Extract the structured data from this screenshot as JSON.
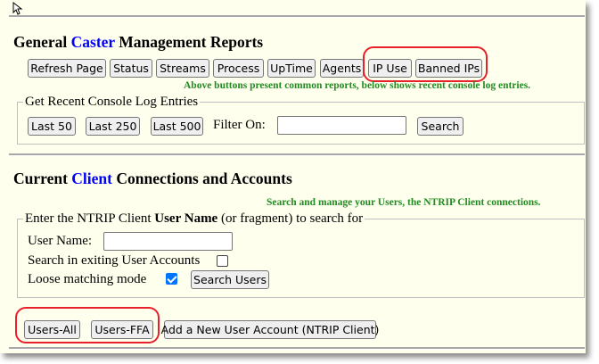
{
  "reports": {
    "title_pre": "General ",
    "title_accent": "Caster",
    "title_post": " Management Reports",
    "buttons": [
      "Refresh Page",
      "Status",
      "Streams",
      "Process",
      "UpTime",
      "Agents",
      "IP Use",
      "Banned IPs"
    ],
    "note": "Above buttons present common reports, below shows recent console log entries."
  },
  "console": {
    "legend": "Get Recent Console Log Entries",
    "buttons": [
      "Last 50",
      "Last 250",
      "Last 500"
    ],
    "filter_label": "Filter On:",
    "filter_value": "",
    "search_label": "Search"
  },
  "clients": {
    "title_pre": "Current ",
    "title_accent": "Client",
    "title_post": " Connections and Accounts",
    "note": "Search and manage your Users, the NTRIP Client connections.",
    "legend_pre": "Enter the NTRIP Client ",
    "legend_bold": "User Name",
    "legend_post": " (or fragment) to search for",
    "user_name_label": "User Name:",
    "user_name_value": "",
    "search_existing_label": "Search in exiting User Accounts",
    "search_existing_checked": false,
    "loose_label": "Loose matching mode",
    "loose_checked": true,
    "search_users_label": "Search Users",
    "users_all_label": "Users-All",
    "users_ffa_label": "Users-FFA",
    "add_user_label": "Add a New User Account (NTRIP Client)"
  },
  "colors": {
    "accent_blue": "#0000ff",
    "note_green": "#228b22",
    "highlight_red": "#e8202a",
    "panel_bg": "#ffffee"
  }
}
